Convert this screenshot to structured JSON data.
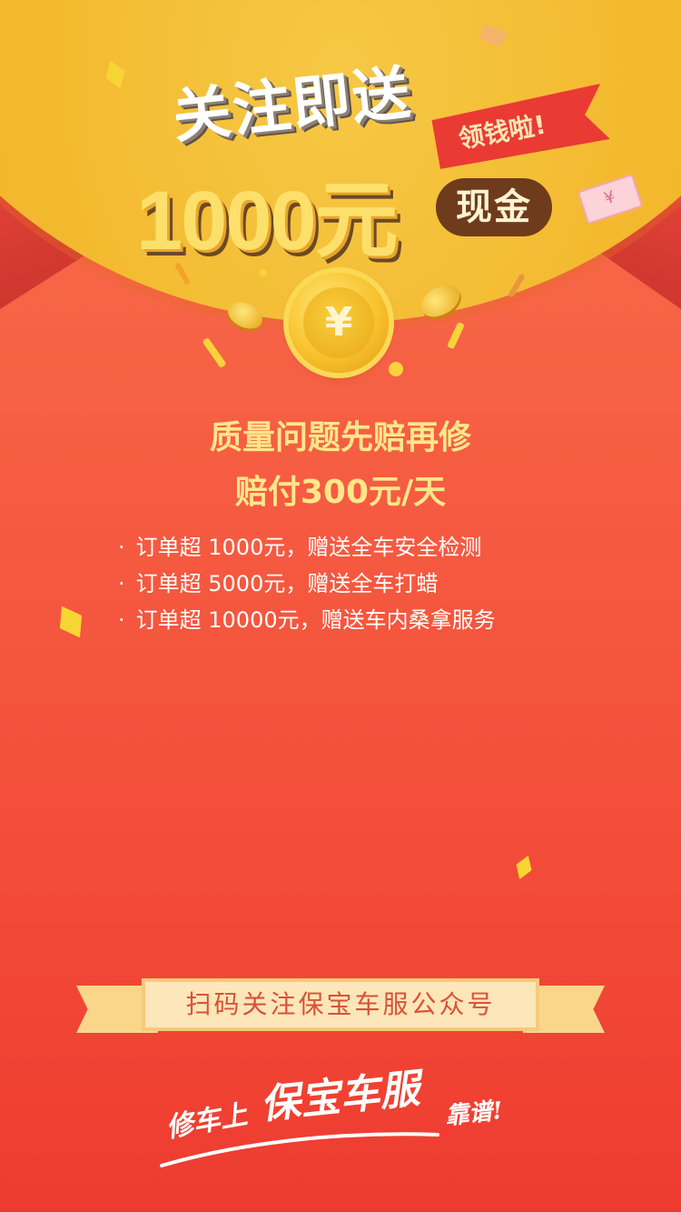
{
  "header": {
    "title_main": "关注即送",
    "tag": "领钱啦!",
    "amount": "1000元",
    "cash_badge": "现金",
    "coin_symbol": "¥"
  },
  "headline": {
    "line1": "质量问题先赔再修",
    "line2": "赔付300元/天"
  },
  "benefits": [
    "订单超 1000元，赠送全车安全检测",
    "订单超 5000元，赠送全车打蜡",
    "订单超 10000元，赠送车内桑拿服务"
  ],
  "banner": {
    "text": "扫码关注保宝车服公众号"
  },
  "slogan": {
    "part1": "修车上",
    "brand": "保宝车服",
    "part2": "靠谱!"
  },
  "colors": {
    "accent": "#f65f43",
    "gold": "#f3b92e",
    "headline": "#ffe78a"
  }
}
